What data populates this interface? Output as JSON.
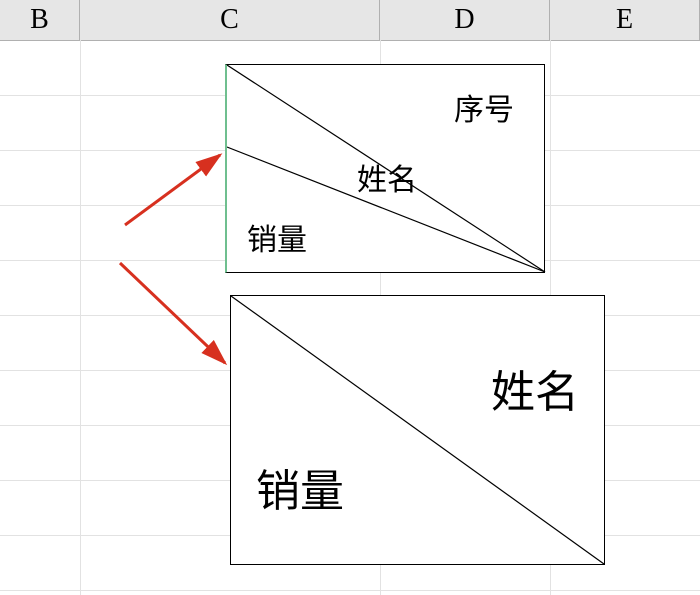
{
  "columns": {
    "B": "B",
    "C": "C",
    "D": "D",
    "E": "E"
  },
  "box_top": {
    "label_top": "序号",
    "label_mid": "姓名",
    "label_bottom": "销量"
  },
  "box_bottom": {
    "label_top": "姓名",
    "label_bottom": "销量"
  },
  "colors": {
    "arrow": "#d7301f",
    "header_bg": "#e6e6e6",
    "gridline": "#e2e2e2"
  }
}
